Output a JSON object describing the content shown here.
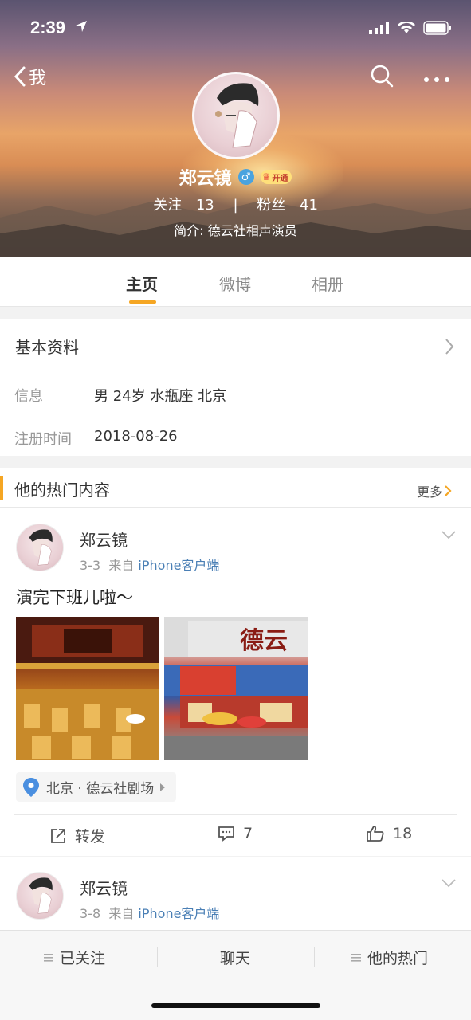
{
  "status_bar": {
    "time": "2:39"
  },
  "nav": {
    "back_label": "我"
  },
  "profile": {
    "name": "郑云镜",
    "gender_symbol": "♂",
    "vip_label": "开通",
    "following_label": "关注",
    "following_count": "13",
    "separator": "|",
    "followers_label": "粉丝",
    "followers_count": "41",
    "bio": "简介: 德云社相声演员"
  },
  "tabs": [
    {
      "label": "主页",
      "active": true
    },
    {
      "label": "微博",
      "active": false
    },
    {
      "label": "相册",
      "active": false
    }
  ],
  "basic_info": {
    "title": "基本资料",
    "rows": [
      {
        "label": "信息",
        "value": "男  24岁  水瓶座  北京"
      },
      {
        "label": "注册时间",
        "value": "2018-08-26"
      }
    ]
  },
  "hot": {
    "title": "他的热门内容",
    "more_label": "更多",
    "posts": [
      {
        "author": "郑云镜",
        "date": "3-3",
        "from_label": "来自",
        "source": "iPhone客户端",
        "text": "演完下班儿啦～",
        "location": "北京 · 德云社剧场",
        "actions": {
          "repost_label": "转发",
          "comment_count": "7",
          "like_count": "18"
        }
      },
      {
        "author": "郑云镜",
        "date": "3-8",
        "from_label": "来自",
        "source": "iPhone客户端"
      }
    ]
  },
  "bottom_bar": {
    "followed_label": "已关注",
    "chat_label": "聊天",
    "hot_label": "他的热门"
  },
  "colors": {
    "accent": "#f5a623",
    "link": "#4a7fb5",
    "gender": "#4aa3df"
  }
}
